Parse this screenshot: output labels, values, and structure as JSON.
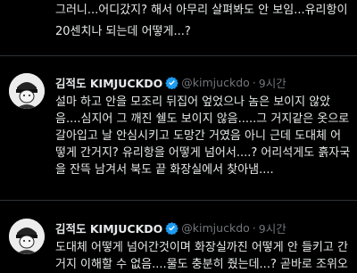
{
  "top_tweet": {
    "text": "그러니...어디갔지? 해서 아무리 살펴봐도 안 보임...유리항이\n20센치나 되는데 어떻게...?"
  },
  "tweets": [
    {
      "name": "김적도 KIMJUCKDO",
      "handle": "@kimjuckdo",
      "separator": "·",
      "time": "9시간",
      "text": "설마 하고 안을 모조리 뒤집어 엎었으나 놈은 보이지 않았\n음....심지어 그 깨진 쉘도 보이지 않음.....그 거지같은 옷으로\n갈아입고 날 안심시키고 도망간 거였음 아니 근데 도대체 어\n떻게 간거지? 유리항을 어떻게 넘어서....? 어리석게도 흙자국\n을 잔뜩 남겨서 북도 끝 화장실에서 찾아냄...."
    },
    {
      "name": "김적도 KIMJUCKDO",
      "handle": "@kimjuckdo",
      "separator": "·",
      "time": "9시간",
      "text": "도대체 어떻게 넘어간것이며 화장실까진 어떻게 안 들키고 간\n거지 이해할 수 없음....물도 충분히 줬는데...? 곧바로 조위오"
    }
  ],
  "colors": {
    "background": "#000000",
    "text": "#e7e9ea",
    "secondary": "#71767b",
    "verified": "#1d9bf0",
    "divider": "#2f3336"
  }
}
